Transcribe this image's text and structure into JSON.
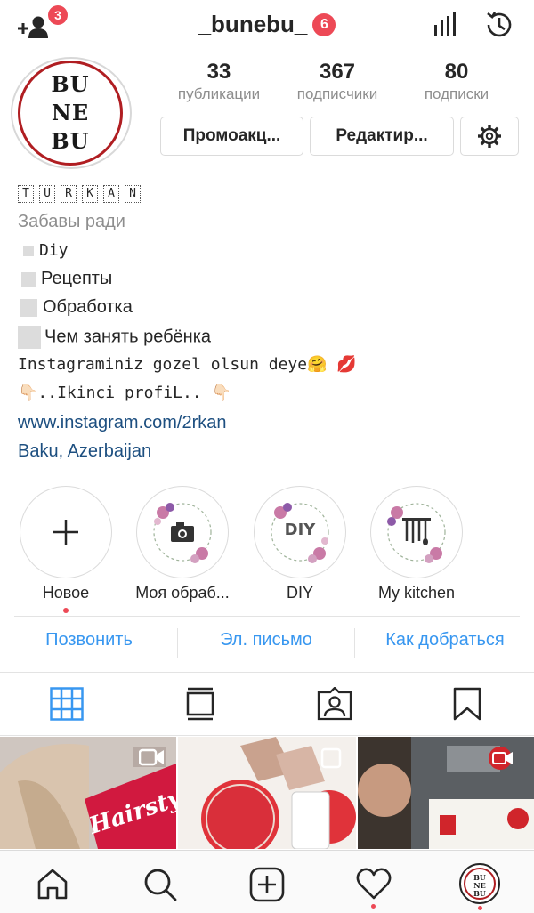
{
  "topbar": {
    "username": "_bunebu_",
    "title_badge": "6",
    "add_user_badge": "3"
  },
  "avatar": {
    "lines": [
      "BU",
      "NE",
      "BU"
    ]
  },
  "stats": [
    {
      "num": "33",
      "label": "публикации"
    },
    {
      "num": "367",
      "label": "подписчики"
    },
    {
      "num": "80",
      "label": "подписки"
    }
  ],
  "buttons": {
    "promo": "Промоакц...",
    "edit": "Редактир..."
  },
  "bio": {
    "name_letters": [
      "T",
      "U",
      "R",
      "K",
      "A",
      "N"
    ],
    "category": "Забавы ради",
    "items": [
      "Diy",
      "Рецепты",
      "Обработка",
      "Чем занять ребёнка"
    ],
    "line1": "Instagraminiz gozel olsun deye🤗 💋",
    "line2": "👇🏻..Ikinci profiL.. 👇🏻",
    "link": "www.instagram.com/2rkan",
    "location": "Baku, Azerbaijan"
  },
  "highlights": [
    {
      "label": "Новое",
      "icon": "plus-icon"
    },
    {
      "label": "Моя обраб...",
      "icon": "camera-icon"
    },
    {
      "label": "DIY",
      "icon": "diy-text"
    },
    {
      "label": "My kitchen",
      "icon": "kitchen-utensils-icon"
    }
  ],
  "highlight_diy_text": "DIY",
  "contact": {
    "call": "Позвонить",
    "email": "Эл. письмо",
    "directions": "Как добраться"
  },
  "grid_text": {
    "hairstyle": "Hairstyle"
  },
  "colors": {
    "accent": "#3897f0",
    "badge": "#ed4956",
    "link": "#1d4f80",
    "avatar_ring": "#b01e22"
  }
}
